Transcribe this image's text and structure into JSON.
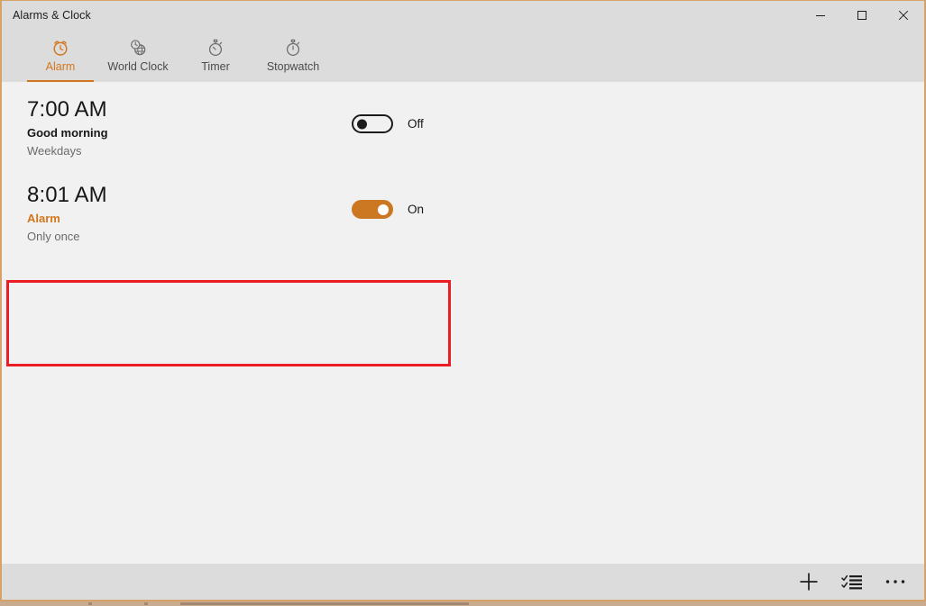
{
  "window": {
    "title": "Alarms & Clock",
    "caption_buttons": [
      {
        "name": "minimize",
        "glyph": "minimize-icon",
        "label": "Minimize"
      },
      {
        "name": "maximize",
        "glyph": "maximize-icon",
        "label": "Maximize"
      },
      {
        "name": "close",
        "glyph": "close-icon",
        "label": "Close"
      }
    ]
  },
  "tabs": [
    {
      "label": "Alarm",
      "icon": "alarm-clock-icon",
      "active": true
    },
    {
      "label": "World Clock",
      "icon": "globe-clock-icon",
      "active": false
    },
    {
      "label": "Timer",
      "icon": "timer-icon",
      "active": false
    },
    {
      "label": "Stopwatch",
      "icon": "stopwatch-icon",
      "active": false
    }
  ],
  "alarms": [
    {
      "time": "7:00 AM",
      "name": "Good morning",
      "repeat": "Weekdays",
      "toggle_state": "Off",
      "enabled": false,
      "highlighted": false
    },
    {
      "time": "8:01 AM",
      "name": "Alarm",
      "repeat": "Only once",
      "toggle_state": "On",
      "enabled": true,
      "highlighted": true
    }
  ],
  "app_bar": [
    {
      "name": "add-alarm",
      "icon": "plus-icon",
      "label": "New alarm"
    },
    {
      "name": "select-alarms",
      "icon": "checklist-icon",
      "label": "Select"
    },
    {
      "name": "more-options",
      "icon": "ellipsis-icon",
      "label": "See more"
    }
  ],
  "colors": {
    "accent": "#d2761e",
    "toggle_on": "#cc7722",
    "highlight": "#ec1c24",
    "chrome": "#dcdcdc",
    "content_bg": "#f1f1f1",
    "window_border": "#d7a26a"
  }
}
